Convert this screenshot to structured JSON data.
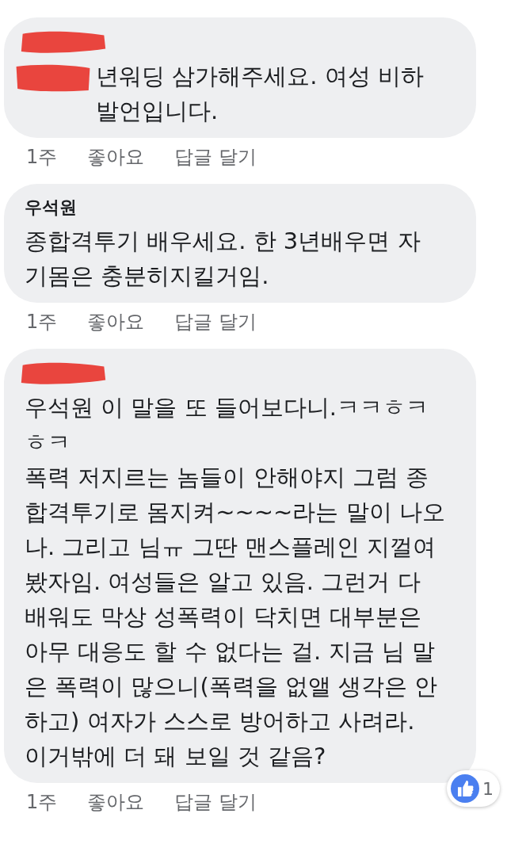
{
  "comments": [
    {
      "author_redacted": true,
      "mention_redacted": true,
      "paragraphs": [
        "년워딩 삼가해주세요. 여성 비하\n발언입니다."
      ],
      "time": "1주",
      "like": "좋아요",
      "reply": "답글 달기"
    },
    {
      "author_redacted": false,
      "author": "우석원",
      "mention_redacted": false,
      "paragraphs": [
        "종합격투기 배우세요. 한 3년배우면 자\n기몸은 충분히지킬거임."
      ],
      "time": "1주",
      "like": "좋아요",
      "reply": "답글 달기"
    },
    {
      "author_redacted": true,
      "mention_redacted": false,
      "paragraphs": [
        "우석원 이 말을 또 들어보다니.ㅋㅋㅎㅋ",
        "ㅎㅋ",
        "폭력 저지르는 놈들이 안해야지 그럼 종\n합격투기로 몸지켜~~~~라는 말이 나오\n나. 그리고 님ㅠ 그딴 맨스플레인 지껄여\n봤자임. 여성들은 알고 있음. 그런거 다\n배워도 막상 성폭력이 닥치면 대부분은\n아무 대응도 할 수 없다는 걸. 지금 님 말\n은 폭력이 많으니(폭력을 없앨 생각은 안\n하고) 여자가 스스로 방어하고 사려라.\n이거밖에 더 돼 보일 것 같음?"
      ],
      "time": "1주",
      "like": "좋아요",
      "reply": "답글 달기",
      "reaction_count": "1"
    }
  ]
}
